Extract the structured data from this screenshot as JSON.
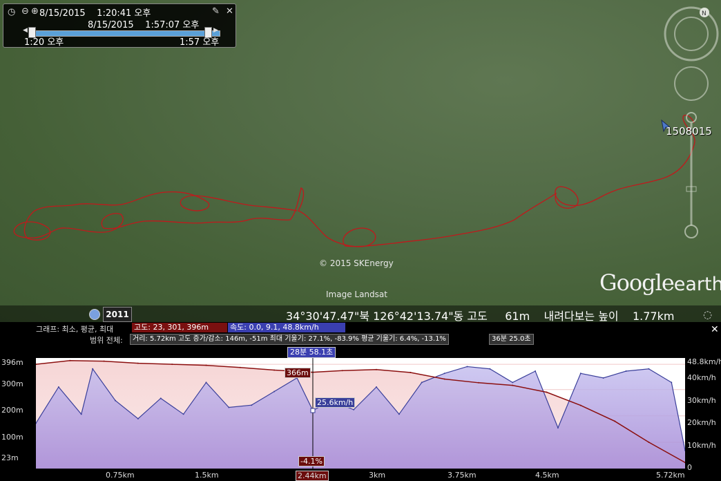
{
  "time_slider": {
    "start_label": "8/15/2015    1:20:41 오후",
    "current_label": "8/15/2015    1:57:07 오후",
    "min_label": "1:20 오후",
    "max_label": "1:57 오후",
    "start_value": 0.0,
    "end_value": 0.94
  },
  "map": {
    "copyright": "© 2015 SKEnergy",
    "imagery": "Image Landsat",
    "logo_google": "Google",
    "logo_earth": "earth",
    "marker_label": "1508015",
    "track_color": "#c0191c"
  },
  "status_bar": {
    "year": "2011",
    "coordinates": "34°30'47.47\"북 126°42'13.74\"동 고도     61m    내려다보는 높이    1.77km"
  },
  "profile": {
    "row1_label": "그래프: 최소, 평균, 최대",
    "elev_badge": "고도: 23, 301, 396m",
    "speed_badge": "속도: 0.0, 9.1, 48.8km/h",
    "row2_label": "범위 전체:",
    "range_stats": "거리: 5.72km 고도 증가/감소: 146m, -51m 최대 기울기: 27.1%, -83.9% 평균 기울기: 6.4%, -13.1%",
    "time_badge": "36분 25.0초",
    "duration_badge": "28분 58.1초",
    "cursor_elev": "366m",
    "cursor_speed": "25.6km/h",
    "cursor_slope": "-4.1%",
    "cursor_dist": "2.44km",
    "elev_color": "#8b0f0f",
    "speed_color": "#3a3f9a"
  },
  "chart_data": {
    "type": "area",
    "x_unit": "km",
    "xlim": [
      0,
      5.72
    ],
    "x_ticks": [
      "0.75km",
      "1.5km",
      "2.44km",
      "3km",
      "3.75km",
      "4.5km",
      "5.72km"
    ],
    "y_left_ticks": [
      "396m",
      "300m",
      "200m",
      "100m",
      "23m"
    ],
    "y_left_lim": [
      0,
      420
    ],
    "y_right_ticks": [
      "48.8km/h",
      "40km/h",
      "30km/h",
      "20km/h",
      "10km/h",
      "0"
    ],
    "y_right_lim": [
      0,
      48.8
    ],
    "series": [
      {
        "name": "고도",
        "unit": "m",
        "x": [
          0,
          0.3,
          0.6,
          0.9,
          1.2,
          1.5,
          1.8,
          2.1,
          2.44,
          2.7,
          3.0,
          3.3,
          3.6,
          3.9,
          4.2,
          4.5,
          4.8,
          5.1,
          5.4,
          5.72
        ],
        "values": [
          396,
          410,
          408,
          400,
          396,
          392,
          384,
          374,
          366,
          372,
          376,
          365,
          340,
          326,
          316,
          290,
          240,
          180,
          100,
          23
        ]
      },
      {
        "name": "속도",
        "unit": "km/h",
        "x": [
          0,
          0.2,
          0.4,
          0.5,
          0.7,
          0.9,
          1.1,
          1.3,
          1.5,
          1.7,
          1.9,
          2.1,
          2.3,
          2.44,
          2.6,
          2.8,
          3.0,
          3.2,
          3.4,
          3.6,
          3.8,
          4.0,
          4.2,
          4.4,
          4.6,
          4.8,
          5.0,
          5.2,
          5.4,
          5.6,
          5.72
        ],
        "values": [
          20,
          36,
          24,
          44,
          30,
          22,
          31,
          24,
          38,
          27,
          28,
          34,
          40,
          25.6,
          30,
          26,
          36,
          24,
          38,
          42,
          45,
          44,
          38,
          43,
          18,
          42,
          40,
          43,
          44,
          38,
          8
        ]
      }
    ]
  }
}
